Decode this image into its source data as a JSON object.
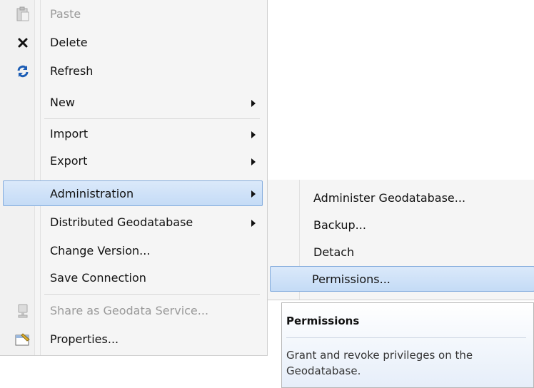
{
  "menu": {
    "items": [
      {
        "label": "Paste",
        "icon": "paste-icon",
        "disabled": true
      },
      {
        "label": "Delete",
        "icon": "delete-icon"
      },
      {
        "label": "Refresh",
        "icon": "refresh-icon"
      },
      {
        "label": "New",
        "submenu": true
      },
      {
        "label": "Import",
        "submenu": true
      },
      {
        "label": "Export",
        "submenu": true
      },
      {
        "label": "Administration",
        "submenu": true,
        "highlighted": true
      },
      {
        "label": "Distributed Geodatabase",
        "submenu": true
      },
      {
        "label": "Change Version..."
      },
      {
        "label": "Save Connection"
      },
      {
        "label": "Share as Geodata Service...",
        "icon": "server-icon",
        "disabled": true
      },
      {
        "label": "Properties...",
        "icon": "properties-icon"
      }
    ]
  },
  "submenu": {
    "items": [
      {
        "label": "Administer Geodatabase..."
      },
      {
        "label": "Backup..."
      },
      {
        "label": "Detach"
      },
      {
        "label": "Permissions...",
        "highlighted": true
      }
    ]
  },
  "tooltip": {
    "title": "Permissions",
    "description": "Grant and revoke privileges on the Geodatabase."
  },
  "colors": {
    "highlight_top": "#dbe9fa",
    "highlight_bottom": "#c4dbf6",
    "highlight_border": "#84acdd",
    "menu_bg": "#f5f5f5"
  }
}
